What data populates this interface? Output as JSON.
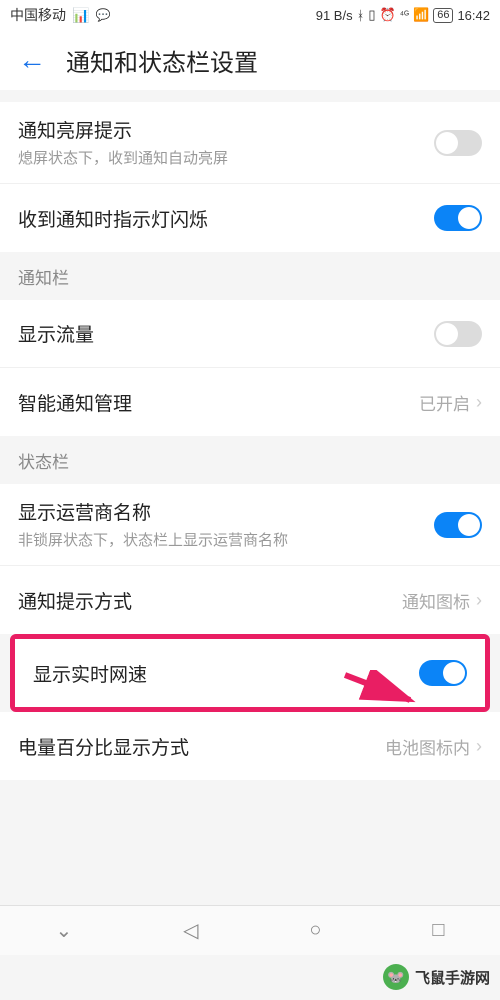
{
  "statusBar": {
    "carrier": "中国移动",
    "speed": "91 B/s",
    "battery": "66",
    "time": "16:42"
  },
  "header": {
    "title": "通知和状态栏设置"
  },
  "rows": {
    "screenOn": {
      "title": "通知亮屏提示",
      "subtitle": "熄屏状态下，收到通知自动亮屏"
    },
    "ledBlink": {
      "title": "收到通知时指示灯闪烁"
    },
    "section1": "通知栏",
    "showTraffic": {
      "title": "显示流量"
    },
    "smartNotify": {
      "title": "智能通知管理",
      "value": "已开启"
    },
    "section2": "状态栏",
    "showCarrier": {
      "title": "显示运营商名称",
      "subtitle": "非锁屏状态下，状态栏上显示运营商名称"
    },
    "notifyMethod": {
      "title": "通知提示方式",
      "value": "通知图标"
    },
    "showSpeed": {
      "title": "显示实时网速"
    },
    "batteryMode": {
      "title": "电量百分比显示方式",
      "value": "电池图标内"
    }
  },
  "watermark": "飞鼠手游网"
}
